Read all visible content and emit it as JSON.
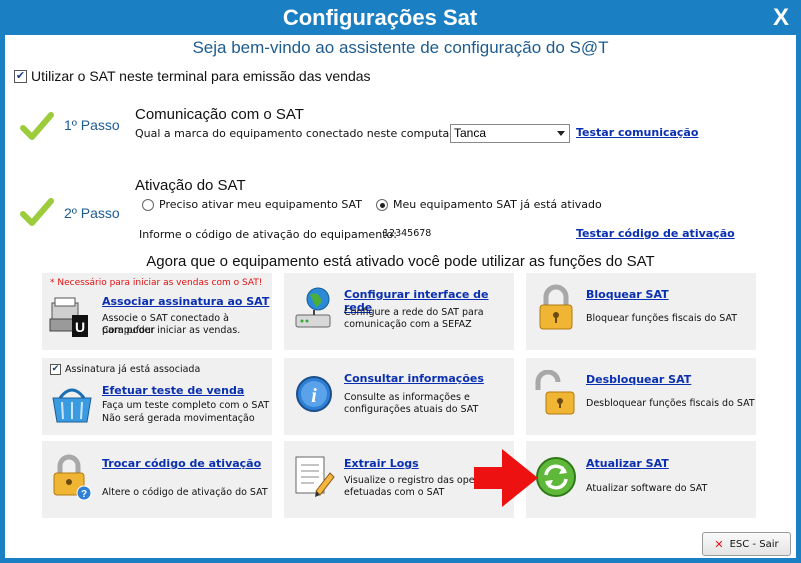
{
  "window": {
    "title": "Configurações Sat",
    "close_label": "X",
    "accent": "#1b7fc4"
  },
  "welcome": "Seja bem-vindo ao assistente de configuração do S@T",
  "use_sat": {
    "checked": true,
    "label": "Utilizar o SAT neste terminal para emissão das vendas"
  },
  "step1": {
    "passo": "1º Passo",
    "heading": "Comunicação com o SAT",
    "question": "Qual a marca do equipamento conectado neste computador?",
    "brand_selected": "Tanca",
    "test_link": "Testar comunicação"
  },
  "step2": {
    "passo": "2º Passo",
    "heading": "Ativação do SAT",
    "option_need": "Preciso ativar meu equipamento SAT",
    "option_active": "Meu equipamento SAT já está ativado",
    "selected": "active",
    "code_label": "Informe o código de ativação do equipamento:",
    "code_value": "12345678",
    "test_link": "Testar código de ativação"
  },
  "functions_heading": "Agora que o equipamento está ativado você pode utilizar as funções do SAT",
  "tiles": {
    "assoc": {
      "warning": "* Necessário para iniciar as vendas com o SAT!",
      "title": "Associar assinatura ao SAT",
      "desc1": "Associe o SAT conectado à Compufour",
      "desc2": "para poder iniciar as vendas."
    },
    "rede": {
      "title": "Configurar interface de rede",
      "desc1": "Configure a rede do SAT para",
      "desc2": "comunicação com a SEFAZ"
    },
    "bloquear": {
      "title": "Bloquear SAT",
      "desc1": "Bloquear funções fiscais do SAT"
    },
    "teste": {
      "assoc_checkbox": "Assinatura já está associada",
      "title": "Efetuar teste de venda",
      "desc1": "Faça um teste completo com o SAT",
      "desc2": "Não será gerada movimentação"
    },
    "consultar": {
      "title": "Consultar informações",
      "desc1": "Consulte as informações e",
      "desc2": "configurações atuais do SAT"
    },
    "desbloquear": {
      "title": "Desbloquear SAT",
      "desc1": "Desbloquear funções fiscais do SAT"
    },
    "trocar": {
      "title": "Trocar código de ativação",
      "desc1": "Altere o código de ativação do SAT"
    },
    "logs": {
      "title": "Extrair Logs",
      "desc1": "Visualize o registro das operaç",
      "desc2": "efetuadas com o SAT"
    },
    "atualizar": {
      "title": "Atualizar SAT",
      "desc1": "Atualizar software do SAT"
    }
  },
  "esc_button": "ESC - Sair"
}
